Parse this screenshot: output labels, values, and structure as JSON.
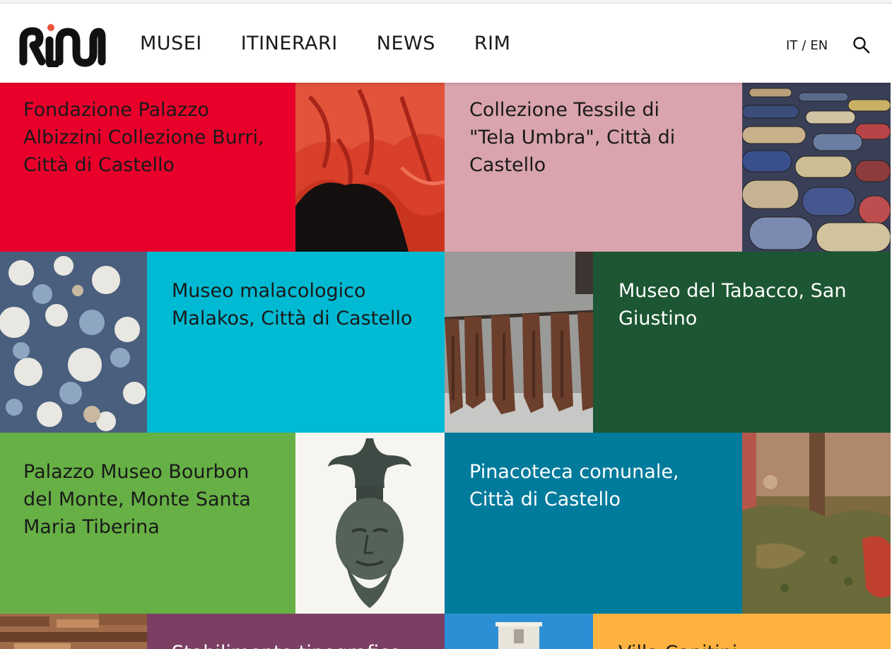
{
  "header": {
    "logo_text": "RIM",
    "nav": [
      "MUSEI",
      "ITINERARI",
      "NEWS",
      "RIM"
    ],
    "lang": {
      "it": "IT",
      "sep": "/",
      "en": "EN"
    }
  },
  "colors": {
    "red": "#e8002b",
    "pink": "#d9a4ad",
    "cyan": "#00bad3",
    "dark_green": "#1c5632",
    "green": "#66b045",
    "teal": "#007b9c",
    "plum": "#7b3f63",
    "amber": "#ffb23f"
  },
  "tiles": [
    {
      "title": "Fondazione Palazzo Albizzini Collezione Burri, Città di Castello",
      "color": "#e8002b",
      "text_color": "#1a1a1a"
    },
    {
      "title": "Collezione Tessile di \"Tela Umbra\", Città di Castello",
      "color": "#d9a4ad",
      "text_color": "#1a1a1a"
    },
    {
      "title": "Museo malacologico Malakos, Città di Castello",
      "color": "#00bad3",
      "text_color": "#1a1a1a"
    },
    {
      "title": "Museo del Tabacco, San Giustino",
      "color": "#1c5632",
      "text_color": "#ffffff"
    },
    {
      "title": "Palazzo Museo Bourbon del Monte, Monte Santa Maria Tiberina",
      "color": "#66b045",
      "text_color": "#1a1a1a"
    },
    {
      "title": "Pinacoteca comunale, Città di Castello",
      "color": "#007b9c",
      "text_color": "#ffffff"
    },
    {
      "title": "Stabilimento tipografico",
      "color": "#7b3f63",
      "text_color": "#ffffff"
    },
    {
      "title": "Villa Capitini",
      "color": "#ffb23f",
      "text_color": "#1a1a1a"
    }
  ]
}
